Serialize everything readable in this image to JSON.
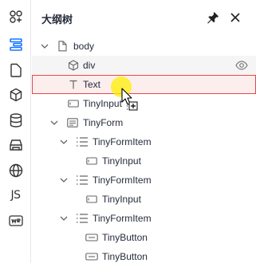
{
  "panel": {
    "title": "大纲树"
  },
  "sidebar": {
    "items": [
      {
        "name": "components",
        "icon": "components-icon"
      },
      {
        "name": "outline",
        "icon": "outline-icon",
        "active": true
      },
      {
        "name": "pages",
        "icon": "page-icon"
      },
      {
        "name": "blocks",
        "icon": "cube-icon"
      },
      {
        "name": "datasource",
        "icon": "database-icon"
      },
      {
        "name": "materials",
        "icon": "bridge-icon"
      },
      {
        "name": "i18n",
        "icon": "globe-icon"
      },
      {
        "name": "js",
        "icon": "js-icon",
        "label": "JS"
      },
      {
        "name": "schema",
        "icon": "schema-icon"
      }
    ]
  },
  "tree": {
    "nodes": [
      {
        "label": "body",
        "icon": "page-icon",
        "depth": 0,
        "expanded": true
      },
      {
        "label": "div",
        "icon": "cube-icon",
        "depth": 1,
        "hovered": true,
        "visibility": "eye-icon"
      },
      {
        "label": "Text",
        "icon": "text-icon",
        "depth": 1,
        "selected": true
      },
      {
        "label": "TinyInput",
        "icon": "input-icon",
        "depth": 1
      },
      {
        "label": "TinyForm",
        "icon": "form-icon",
        "depth": 1,
        "expanded": true
      },
      {
        "label": "TinyFormItem",
        "icon": "list-icon",
        "depth": 2,
        "expanded": true
      },
      {
        "label": "TinyInput",
        "icon": "input-icon",
        "depth": 3
      },
      {
        "label": "TinyFormItem",
        "icon": "list-icon",
        "depth": 2,
        "expanded": true
      },
      {
        "label": "TinyInput",
        "icon": "input-icon",
        "depth": 3
      },
      {
        "label": "TinyFormItem",
        "icon": "list-icon",
        "depth": 2,
        "expanded": true
      },
      {
        "label": "TinyButton",
        "icon": "button-icon",
        "depth": 3
      },
      {
        "label": "TinyButton",
        "icon": "button-icon",
        "depth": 3
      }
    ]
  },
  "colors": {
    "accent": "#1476ff",
    "selected_border": "#e6484b",
    "selected_bg": "#fdeeee",
    "hover_bg": "#f5f5f5"
  }
}
